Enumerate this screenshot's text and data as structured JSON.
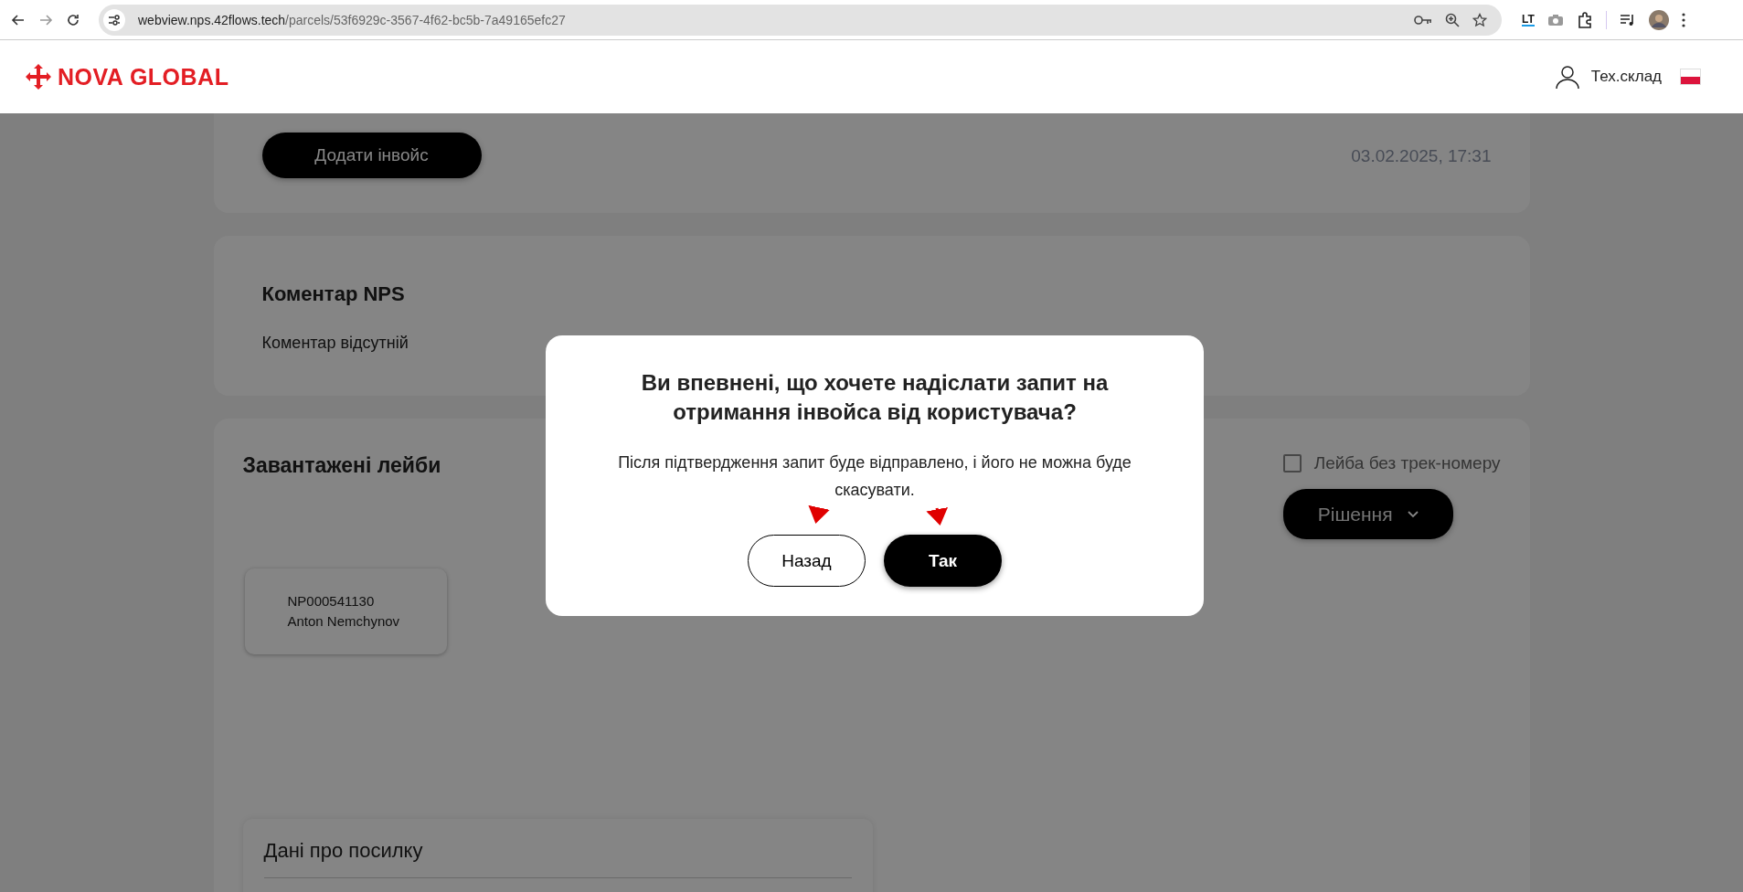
{
  "browser": {
    "url_host": "webview.nps.42flows.tech",
    "url_path": "/parcels/53f6929c-3567-4f62-bc5b-7a49165efc27",
    "extension_badge": "LT"
  },
  "header": {
    "logo": "NOVA GLOBAL",
    "user": "Тех.склад"
  },
  "invoice_card": {
    "button": "Додати інвойс",
    "timestamp": "03.02.2025, 17:31"
  },
  "comment_card": {
    "title": "Коментар NPS",
    "text": "Коментар відсутній"
  },
  "labels_section": {
    "title": "Завантажені лейби",
    "no_track_checkbox": {
      "label": "Лейба без трек-номеру",
      "checked": false
    },
    "decision_button": "Рішення",
    "labels": [
      {
        "tracking": "NP000541130",
        "name": "Anton Nemchynov"
      }
    ],
    "parcel_details": {
      "title": "Дані про посилку"
    }
  },
  "modal": {
    "title": "Ви впевнені, що хочете надіслати запит на отримання інвойса від користувача?",
    "message": "Після підтвердження запит буде відправлено, і його не можна буде скасувати.",
    "buttons": [
      {
        "label": "Назад",
        "kind": "secondary"
      },
      {
        "label": "Так",
        "kind": "primary"
      }
    ]
  }
}
